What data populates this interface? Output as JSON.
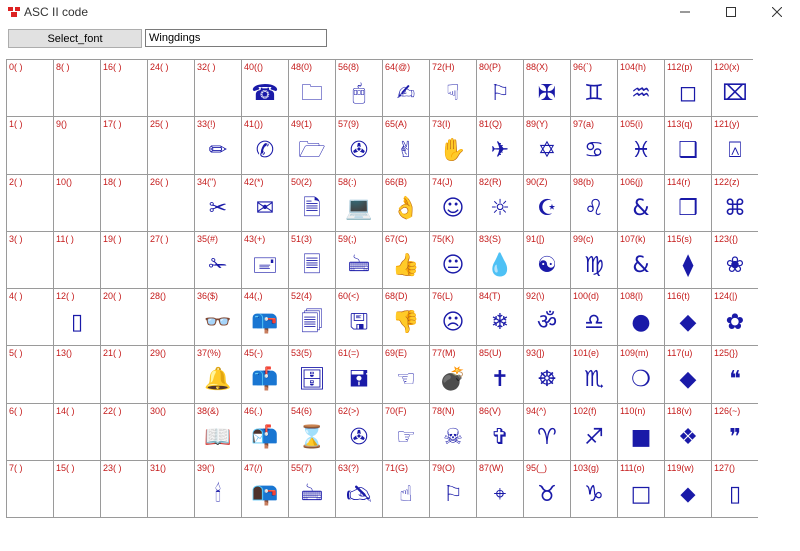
{
  "window": {
    "title": "ASC II code"
  },
  "toolbar": {
    "select_font_label": "Select_font",
    "font_value": "Wingdings"
  },
  "colors": {
    "label": "#c41a1a",
    "glyph": "#1a1aa8",
    "grid": "#9a9a9a"
  },
  "cells": [
    {
      "label": "0( )",
      "glyph": ""
    },
    {
      "label": "8( )",
      "glyph": ""
    },
    {
      "label": "16( )",
      "glyph": ""
    },
    {
      "label": "24( )",
      "glyph": ""
    },
    {
      "label": "32( )",
      "glyph": ""
    },
    {
      "label": "40(()",
      "glyph": "☎"
    },
    {
      "label": "48(0)",
      "glyph": "🗀"
    },
    {
      "label": "56(8)",
      "glyph": "🖱"
    },
    {
      "label": "64(@)",
      "glyph": "✍"
    },
    {
      "label": "72(H)",
      "glyph": "☟"
    },
    {
      "label": "80(P)",
      "glyph": "⚐"
    },
    {
      "label": "88(X)",
      "glyph": "✠"
    },
    {
      "label": "96(`)",
      "glyph": "♊"
    },
    {
      "label": "104(h)",
      "glyph": "♒"
    },
    {
      "label": "112(p)",
      "glyph": "◻"
    },
    {
      "label": "120(x)",
      "glyph": "⌧"
    },
    {
      "label": "1( )",
      "glyph": ""
    },
    {
      "label": "9()",
      "glyph": ""
    },
    {
      "label": "17( )",
      "glyph": ""
    },
    {
      "label": "25( )",
      "glyph": ""
    },
    {
      "label": "33(!)",
      "glyph": "✏"
    },
    {
      "label": "41())",
      "glyph": "✆"
    },
    {
      "label": "49(1)",
      "glyph": "🗁"
    },
    {
      "label": "57(9)",
      "glyph": "✇"
    },
    {
      "label": "65(A)",
      "glyph": "✌"
    },
    {
      "label": "73(I)",
      "glyph": "✋"
    },
    {
      "label": "81(Q)",
      "glyph": "✈"
    },
    {
      "label": "89(Y)",
      "glyph": "✡"
    },
    {
      "label": "97(a)",
      "glyph": "♋"
    },
    {
      "label": "105(i)",
      "glyph": "♓"
    },
    {
      "label": "113(q)",
      "glyph": "❑"
    },
    {
      "label": "121(y)",
      "glyph": "⍓"
    },
    {
      "label": "2( )",
      "glyph": ""
    },
    {
      "label": "10()",
      "glyph": ""
    },
    {
      "label": "18( )",
      "glyph": ""
    },
    {
      "label": "26( )",
      "glyph": ""
    },
    {
      "label": "34(\")",
      "glyph": "✂"
    },
    {
      "label": "42(*)",
      "glyph": "✉"
    },
    {
      "label": "50(2)",
      "glyph": "🗎"
    },
    {
      "label": "58(:)",
      "glyph": "💻"
    },
    {
      "label": "66(B)",
      "glyph": "👌"
    },
    {
      "label": "74(J)",
      "glyph": "☺"
    },
    {
      "label": "82(R)",
      "glyph": "☼"
    },
    {
      "label": "90(Z)",
      "glyph": "☪"
    },
    {
      "label": "98(b)",
      "glyph": "♌"
    },
    {
      "label": "106(j)",
      "glyph": "&"
    },
    {
      "label": "114(r)",
      "glyph": "❒"
    },
    {
      "label": "122(z)",
      "glyph": "⌘"
    },
    {
      "label": "3( )",
      "glyph": ""
    },
    {
      "label": "11( )",
      "glyph": ""
    },
    {
      "label": "19( )",
      "glyph": ""
    },
    {
      "label": "27( )",
      "glyph": ""
    },
    {
      "label": "35(#)",
      "glyph": "✁"
    },
    {
      "label": "43(+)",
      "glyph": "🖃"
    },
    {
      "label": "51(3)",
      "glyph": "🗏"
    },
    {
      "label": "59(;)",
      "glyph": "🖮"
    },
    {
      "label": "67(C)",
      "glyph": "👍"
    },
    {
      "label": "75(K)",
      "glyph": "😐"
    },
    {
      "label": "83(S)",
      "glyph": "💧"
    },
    {
      "label": "91([)",
      "glyph": "☯"
    },
    {
      "label": "99(c)",
      "glyph": "♍"
    },
    {
      "label": "107(k)",
      "glyph": "&"
    },
    {
      "label": "115(s)",
      "glyph": "⧫"
    },
    {
      "label": "123({)",
      "glyph": "❀"
    },
    {
      "label": "4( )",
      "glyph": ""
    },
    {
      "label": "12( )",
      "glyph": "▯"
    },
    {
      "label": "20( )",
      "glyph": ""
    },
    {
      "label": "28()",
      "glyph": ""
    },
    {
      "label": "36($)",
      "glyph": "👓"
    },
    {
      "label": "44(,)",
      "glyph": "📪"
    },
    {
      "label": "52(4)",
      "glyph": "🗐"
    },
    {
      "label": "60(<)",
      "glyph": "🖫"
    },
    {
      "label": "68(D)",
      "glyph": "👎"
    },
    {
      "label": "76(L)",
      "glyph": "☹"
    },
    {
      "label": "84(T)",
      "glyph": "❄"
    },
    {
      "label": "92(\\)",
      "glyph": "ॐ"
    },
    {
      "label": "100(d)",
      "glyph": "♎"
    },
    {
      "label": "108(l)",
      "glyph": "●"
    },
    {
      "label": "116(t)",
      "glyph": "◆"
    },
    {
      "label": "124(|)",
      "glyph": "✿"
    },
    {
      "label": "5( )",
      "glyph": ""
    },
    {
      "label": "13()",
      "glyph": ""
    },
    {
      "label": "21( )",
      "glyph": ""
    },
    {
      "label": "29()",
      "glyph": ""
    },
    {
      "label": "37(%)",
      "glyph": "🔔"
    },
    {
      "label": "45(-)",
      "glyph": "📫"
    },
    {
      "label": "53(5)",
      "glyph": "🗄"
    },
    {
      "label": "61(=)",
      "glyph": "🖬"
    },
    {
      "label": "69(E)",
      "glyph": "☜"
    },
    {
      "label": "77(M)",
      "glyph": "💣"
    },
    {
      "label": "85(U)",
      "glyph": "✝"
    },
    {
      "label": "93(])",
      "glyph": "☸"
    },
    {
      "label": "101(e)",
      "glyph": "♏"
    },
    {
      "label": "109(m)",
      "glyph": "❍"
    },
    {
      "label": "117(u)",
      "glyph": "◆"
    },
    {
      "label": "125(})",
      "glyph": "❝"
    },
    {
      "label": "6( )",
      "glyph": ""
    },
    {
      "label": "14( )",
      "glyph": ""
    },
    {
      "label": "22( )",
      "glyph": ""
    },
    {
      "label": "30()",
      "glyph": ""
    },
    {
      "label": "38(&)",
      "glyph": "📖"
    },
    {
      "label": "46(.)",
      "glyph": "📬"
    },
    {
      "label": "54(6)",
      "glyph": "⌛"
    },
    {
      "label": "62(>)",
      "glyph": "✇"
    },
    {
      "label": "70(F)",
      "glyph": "☞"
    },
    {
      "label": "78(N)",
      "glyph": "☠"
    },
    {
      "label": "86(V)",
      "glyph": "✞"
    },
    {
      "label": "94(^)",
      "glyph": "♈"
    },
    {
      "label": "102(f)",
      "glyph": "♐"
    },
    {
      "label": "110(n)",
      "glyph": "■"
    },
    {
      "label": "118(v)",
      "glyph": "❖"
    },
    {
      "label": "126(~)",
      "glyph": "❞"
    },
    {
      "label": "7( )",
      "glyph": ""
    },
    {
      "label": "15( )",
      "glyph": ""
    },
    {
      "label": "23( )",
      "glyph": ""
    },
    {
      "label": "31()",
      "glyph": ""
    },
    {
      "label": "39(')",
      "glyph": "🕯"
    },
    {
      "label": "47(/)",
      "glyph": "📭"
    },
    {
      "label": "55(7)",
      "glyph": "🖮"
    },
    {
      "label": "63(?)",
      "glyph": "🖎"
    },
    {
      "label": "71(G)",
      "glyph": "☝"
    },
    {
      "label": "79(O)",
      "glyph": "⚐"
    },
    {
      "label": "87(W)",
      "glyph": "⌖"
    },
    {
      "label": "95(_)",
      "glyph": "♉"
    },
    {
      "label": "103(g)",
      "glyph": "♑"
    },
    {
      "label": "111(o)",
      "glyph": "□"
    },
    {
      "label": "119(w)",
      "glyph": "⬥"
    },
    {
      "label": "127()",
      "glyph": "▯"
    }
  ]
}
